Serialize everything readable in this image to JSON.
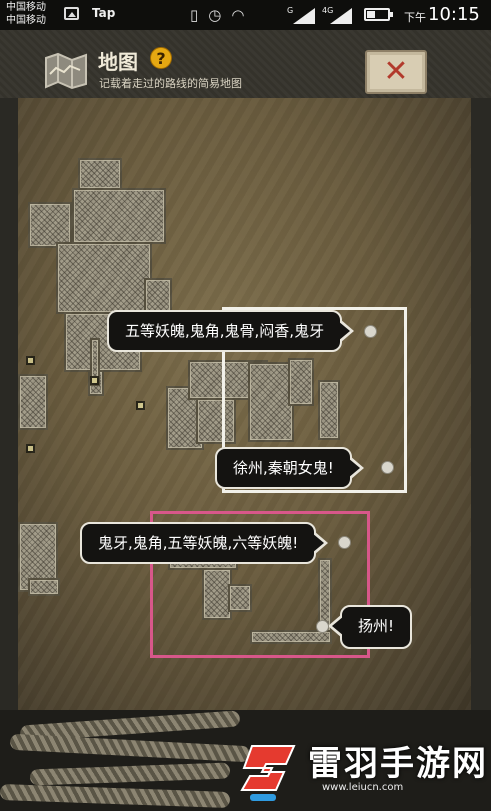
{
  "status_bar": {
    "carrier_1": "中国移动",
    "carrier_2": "中国移动",
    "app_label": "Tap",
    "signal_1": "G",
    "signal_2": "4G",
    "ampm": "下午",
    "time": "10:15"
  },
  "header": {
    "title": "地图",
    "help_symbol": "?",
    "subtitle": "记载着走过的路线的简易地图",
    "close_symbol": "✕"
  },
  "map": {
    "callouts": [
      {
        "text": "五等妖魄,鬼角,鬼骨,闷香,鬼牙"
      },
      {
        "text": "徐州,秦朝女鬼!"
      },
      {
        "text": "鬼牙,鬼角,五等妖魄,六等妖魄!"
      },
      {
        "text": "扬州!"
      }
    ],
    "highlight_colors": {
      "box_1": "#f2f1ea",
      "box_2": "#d8578a"
    }
  },
  "watermark": {
    "name": "雷羽手游网",
    "url": "www.leiucn.com"
  }
}
